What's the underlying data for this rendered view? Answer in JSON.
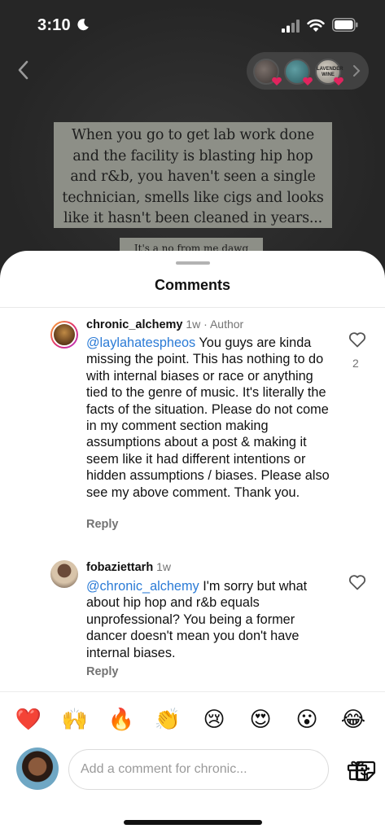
{
  "status_bar": {
    "time": "3:10"
  },
  "story_pill": {
    "badge_text": "LAVENDER WINE"
  },
  "post": {
    "meme_text": "When you go to get lab work done and the facility is blasting hip hop and r&b, you haven't seen a single technician, smells like cigs and looks like it hasn't been cleaned in years...",
    "meme_text_2": "It's a no from me dawg"
  },
  "sheet": {
    "title": "Comments"
  },
  "comments": [
    {
      "username": "chronic_alchemy",
      "age": "1w",
      "role": "· Author",
      "mention": "@laylahatespheos",
      "text": " You guys are kinda missing the point. This has nothing to do with internal biases or race or anything tied to the genre of music. It's literally the facts of the situation. Please do not come in my comment section making assumptions about a post & making it seem like it had different intentions or hidden assumptions / biases. Please also see my above comment. Thank you.",
      "reply_label": "Reply",
      "like_count": "2"
    },
    {
      "username": "fobaziettarh",
      "age": "1w",
      "mention": "@chronic_alchemy",
      "text": " I'm sorry but what about hip hop and r&b equals unprofessional? You being a former dancer doesn't mean you don't have internal biases.",
      "reply_label": "Reply"
    }
  ],
  "quick_reactions": [
    "❤️",
    "🙌",
    "🔥",
    "👏",
    "😢",
    "😍",
    "😮",
    "😂"
  ],
  "composer": {
    "placeholder": "Add a comment for chronic..."
  },
  "colors": {
    "mention": "#2b7bd6",
    "secondary_text": "#737373",
    "ring_start": "#f9b02c",
    "ring_end": "#b832c4"
  },
  "icons": [
    "moon-icon",
    "signal-icon",
    "wifi-icon",
    "battery-icon",
    "back-chevron-icon",
    "heart-icon",
    "sticker-icon",
    "gift-icon"
  ]
}
